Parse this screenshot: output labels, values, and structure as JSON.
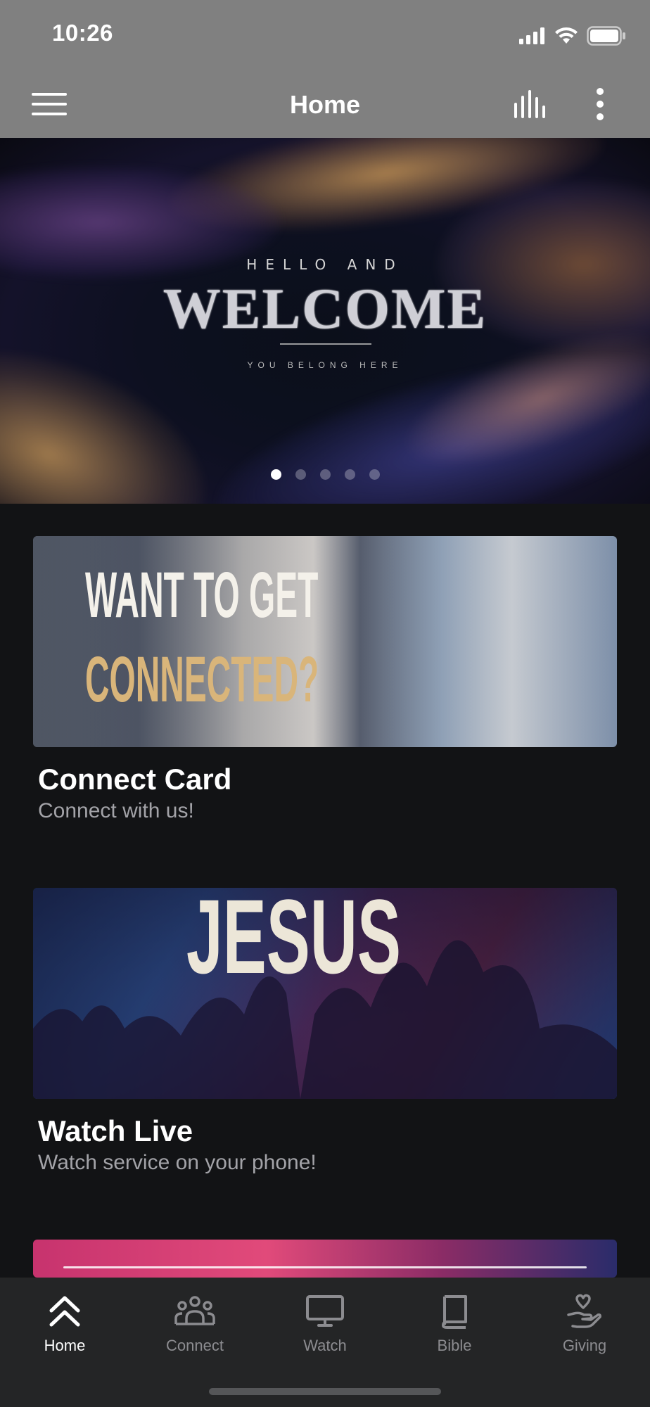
{
  "status_bar": {
    "time": "10:26"
  },
  "header": {
    "title": "Home"
  },
  "hero": {
    "line1": "HELLO AND",
    "title": "WELCOME",
    "line2": "YOU BELONG HERE",
    "slide_count": 5,
    "active_slide": 1
  },
  "cards": [
    {
      "title": "Connect Card",
      "subtitle": "Connect with us!",
      "image_text_line1": "WANT TO GET",
      "image_text_line2": "CONNECTED?"
    },
    {
      "title": "Watch Live",
      "subtitle": "Watch service on your phone!",
      "image_text": "JESUS"
    }
  ],
  "tabs": [
    {
      "label": "Home",
      "icon": "home-chevrons-icon",
      "active": true
    },
    {
      "label": "Connect",
      "icon": "people-icon",
      "active": false
    },
    {
      "label": "Watch",
      "icon": "monitor-icon",
      "active": false
    },
    {
      "label": "Bible",
      "icon": "book-icon",
      "active": false
    },
    {
      "label": "Giving",
      "icon": "giving-hand-icon",
      "active": false
    }
  ],
  "colors": {
    "header_bg": "#808080",
    "page_bg": "#121315",
    "tabbar_bg": "#242526",
    "accent_gold": "#d9b57a"
  }
}
